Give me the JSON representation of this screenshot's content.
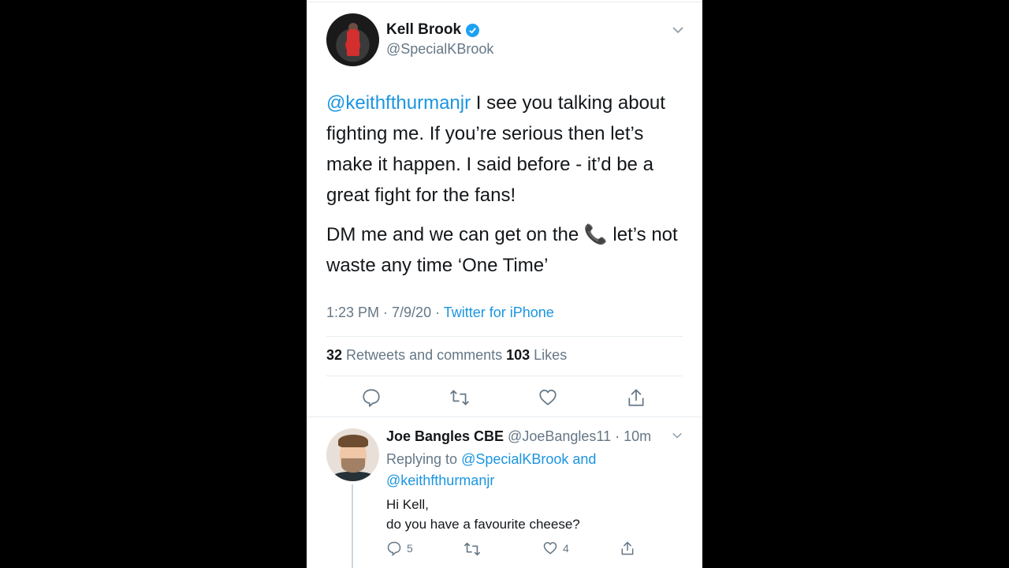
{
  "tweet": {
    "author_name": "Kell Brook",
    "author_handle": "@SpecialKBrook",
    "text_mention": "@keithfthurmanjr",
    "text_line1_rest": " I see you talking about fighting me. If you’re serious then let’s make it happen. I said before - it’d be a great fight for the fans!",
    "text_line2": "DM me and we can get on the 📞 let’s not waste any time ‘One Time’",
    "time": "1:23 PM · 7/9/20 · ",
    "source": "Twitter for iPhone",
    "retweets_count": "32",
    "retweets_label": " Retweets and comments ",
    "likes_count": "103",
    "likes_label": " Likes"
  },
  "reply": {
    "author_name": "Joe Bangles CBE",
    "author_handle_time": " @JoeBangles11 · 10m",
    "replying_prefix": "Replying to ",
    "replying_mentions": "@SpecialKBrook and @keithfthurmanjr",
    "line1": "Hi Kell,",
    "line2": "do you have a favourite cheese?",
    "comment_count": "5",
    "like_count": "4"
  },
  "icons": {
    "verified": "verified-badge-icon",
    "chevron": "chevron-down-icon",
    "reply": "reply-icon",
    "retweet": "retweet-icon",
    "like": "heart-icon",
    "share": "share-icon"
  },
  "colors": {
    "accent": "#1b95e0",
    "secondary_text": "#657786",
    "primary_text": "#14171a"
  }
}
